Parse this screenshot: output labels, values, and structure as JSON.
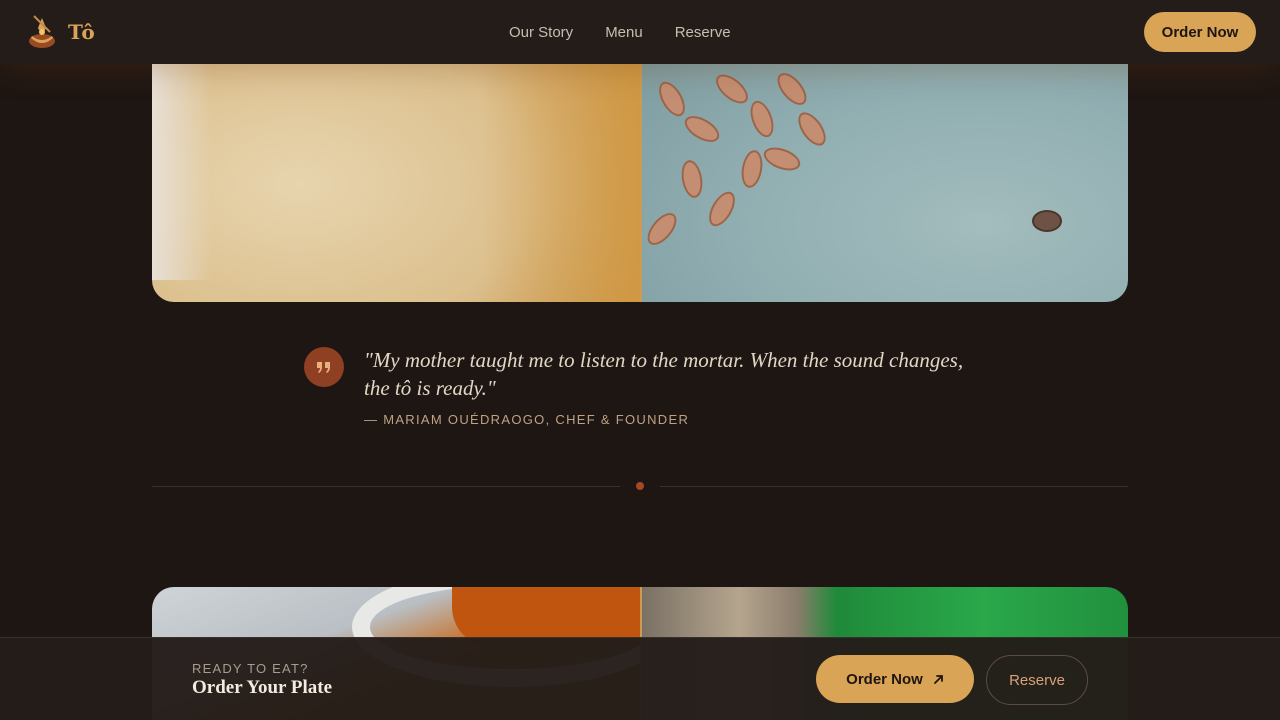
{
  "nav": {
    "brand_name": "Tô",
    "links": [
      "Our Story",
      "Menu",
      "Reserve"
    ],
    "order_label": "Order Now"
  },
  "quote": {
    "text": "\"My mother taught me to listen to the mortar. When the sound changes, the tô is ready.\"",
    "author": "— Mariam Ouédraogo, Chef & Founder"
  },
  "cta": {
    "eyebrow": "Ready to eat?",
    "title": "Order Your Plate",
    "order_label": "Order Now",
    "reserve_label": "Reserve"
  },
  "colors": {
    "background": "#1e1613",
    "accent_gold": "#d9a455",
    "accent_rust": "#8f3f22"
  },
  "icons": {
    "brand": "flame-mortar-logo",
    "quote": "quote-icon",
    "order_arrow": "arrow-up-right-icon"
  }
}
